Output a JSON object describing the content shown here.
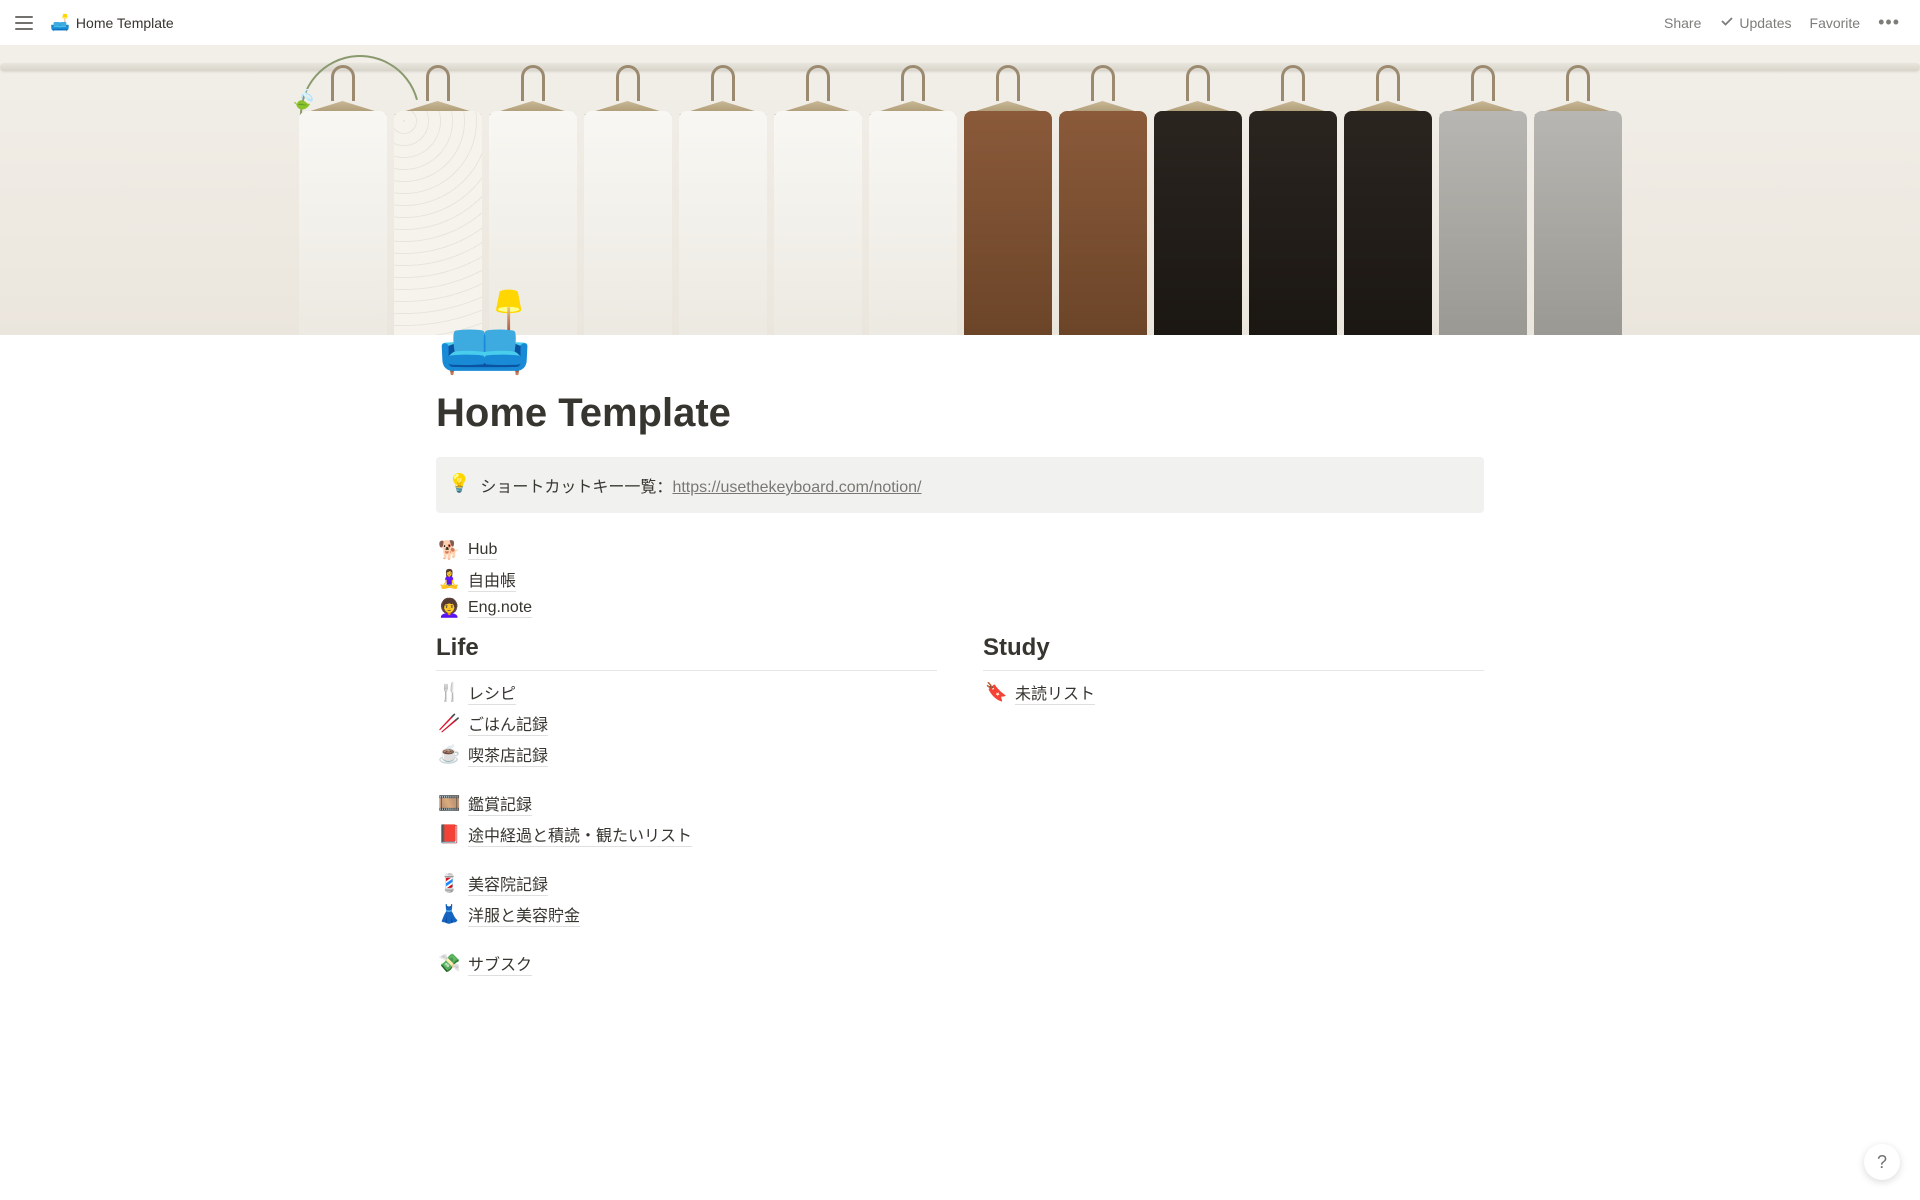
{
  "topbar": {
    "breadcrumb_icon": "🛋️",
    "breadcrumb_title": "Home Template",
    "share": "Share",
    "updates": "Updates",
    "favorite": "Favorite"
  },
  "page": {
    "icon": "🛋️",
    "title": "Home Template"
  },
  "callout": {
    "icon": "💡",
    "text": "ショートカットキー一覧：",
    "link": "https://usethekeyboard.com/notion/"
  },
  "top_links": [
    {
      "emoji": "🐕",
      "label": "Hub"
    },
    {
      "emoji": "🧘‍♀️",
      "label": "自由帳"
    },
    {
      "emoji": "👩‍🦱",
      "label": "Eng.note"
    }
  ],
  "columns": {
    "left": {
      "heading": "Life",
      "groups": [
        [
          {
            "emoji": "🍴",
            "label": "レシピ"
          },
          {
            "emoji": "🥢",
            "label": "ごはん記録"
          },
          {
            "emoji": "☕",
            "label": "喫茶店記録"
          }
        ],
        [
          {
            "emoji": "🎞️",
            "label": "鑑賞記録"
          },
          {
            "emoji": "📕",
            "label": "途中経過と積読・観たいリスト"
          }
        ],
        [
          {
            "emoji": "💈",
            "label": "美容院記録"
          },
          {
            "emoji": "👗",
            "label": "洋服と美容貯金"
          }
        ],
        [
          {
            "emoji": "💸",
            "label": "サブスク"
          }
        ]
      ]
    },
    "right": {
      "heading": "Study",
      "groups": [
        [
          {
            "emoji": "🔖",
            "label": "未読リスト"
          }
        ]
      ]
    }
  },
  "help": "?"
}
